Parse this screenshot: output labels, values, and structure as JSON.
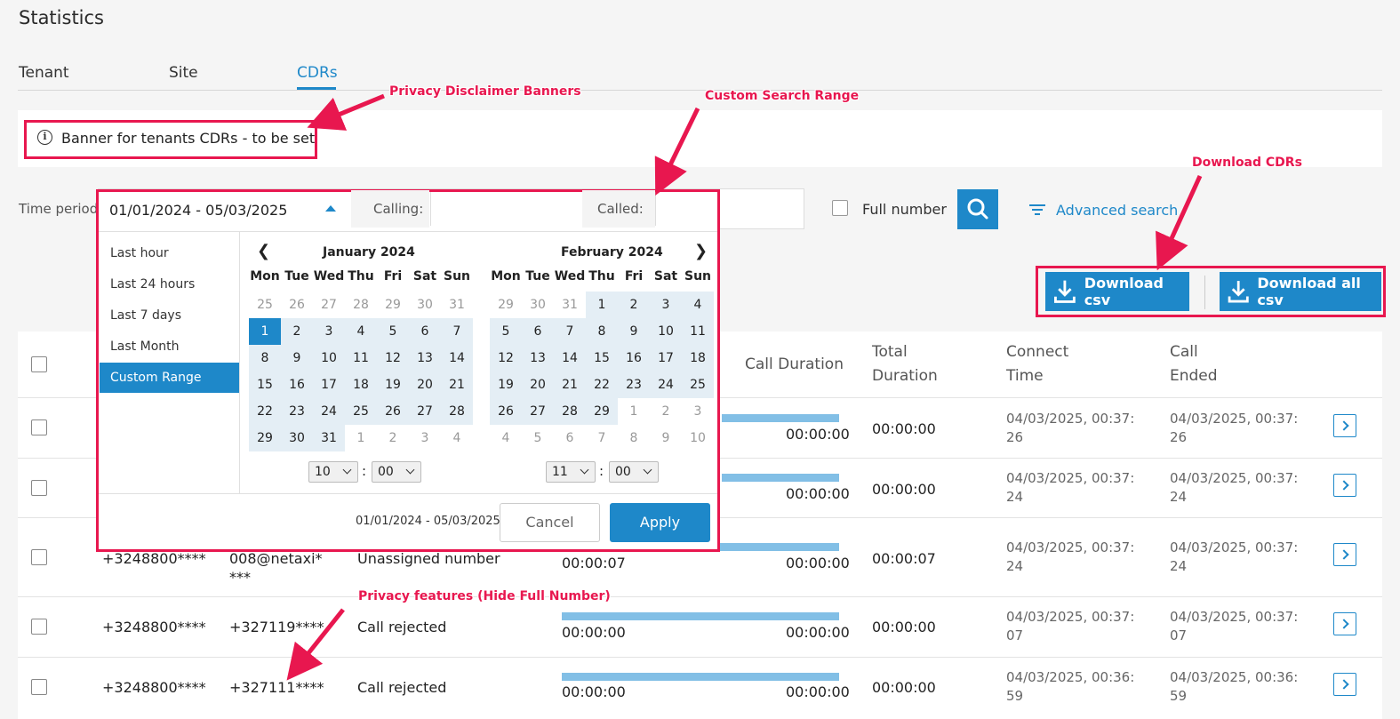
{
  "page": {
    "title": "Statistics"
  },
  "tabs": [
    {
      "label": "Tenant"
    },
    {
      "label": "Site"
    },
    {
      "label": "CDRs"
    }
  ],
  "banner": {
    "text": "Banner for tenants CDRs - to be set"
  },
  "filters": {
    "time_label": "Time period",
    "time_value": "01/01/2024 - 05/03/2025",
    "calling_label": "Calling:",
    "called_label": "Called:",
    "full_number_label": "Full number",
    "advanced_search": "Advanced search"
  },
  "downloads": {
    "csv": "Download csv",
    "all_csv": "Download all csv"
  },
  "datepicker": {
    "ranges": [
      "Last hour",
      "Last 24 hours",
      "Last 7 days",
      "Last Month",
      "Custom Range"
    ],
    "active_range": "Custom Range",
    "weekdays": [
      "Mon",
      "Tue",
      "Wed",
      "Thu",
      "Fri",
      "Sat",
      "Sun"
    ],
    "left_month": "January 2024",
    "right_month": "February 2024",
    "left_days": [
      25,
      26,
      27,
      28,
      29,
      30,
      31,
      1,
      2,
      3,
      4,
      5,
      6,
      7,
      8,
      9,
      10,
      11,
      12,
      13,
      14,
      15,
      16,
      17,
      18,
      19,
      20,
      21,
      22,
      23,
      24,
      25,
      26,
      27,
      28,
      29,
      30,
      31,
      1,
      2,
      3,
      4
    ],
    "right_days": [
      29,
      30,
      31,
      1,
      2,
      3,
      4,
      5,
      6,
      7,
      8,
      9,
      10,
      11,
      12,
      13,
      14,
      15,
      16,
      17,
      18,
      19,
      20,
      21,
      22,
      23,
      24,
      25,
      26,
      27,
      28,
      29,
      1,
      2,
      3,
      4,
      5,
      6,
      7,
      8,
      9,
      10
    ],
    "left_time": {
      "hour": "10",
      "minute": "00"
    },
    "right_time": {
      "hour": "11",
      "minute": "00"
    },
    "time_separator": ":",
    "footer_range": "01/01/2024 - 05/03/2025",
    "cancel": "Cancel",
    "apply": "Apply"
  },
  "table": {
    "headers": {
      "call_duration": "Call Duration",
      "total_duration": "Total Duration",
      "connect_time": "Connect Time",
      "call_ended": "Call Ended"
    },
    "rows": [
      {
        "calling": "",
        "called": "",
        "result": "",
        "duration": "",
        "call_duration": "00:00:00",
        "total": "00:00:00",
        "connect": "04/03/2025, 00:37:26",
        "ended": "04/03/2025, 00:37:26"
      },
      {
        "calling": "",
        "called": "",
        "result": "",
        "duration": "",
        "call_duration": "00:00:00",
        "total": "00:00:00",
        "connect": "04/03/2025, 00:37:24",
        "ended": "04/03/2025, 00:37:24"
      },
      {
        "calling": "+3248800****",
        "called": "008@netaxi****",
        "result": "Unassigned number",
        "duration": "00:00:07",
        "call_duration": "00:00:00",
        "total": "00:00:07",
        "connect": "04/03/2025, 00:37:24",
        "ended": "04/03/2025, 00:37:24"
      },
      {
        "calling": "+3248800****",
        "called": "+327119****",
        "result": "Call rejected",
        "duration": "00:00:00",
        "call_duration": "00:00:00",
        "total": "00:00:00",
        "connect": "04/03/2025, 00:37:07",
        "ended": "04/03/2025, 00:37:07"
      },
      {
        "calling": "+3248800****",
        "called": "+327111****",
        "result": "Call rejected",
        "duration": "00:00:00",
        "call_duration": "00:00:00",
        "total": "00:00:00",
        "connect": "04/03/2025, 00:36:59",
        "ended": "04/03/2025, 00:36:59"
      }
    ]
  },
  "annotations": {
    "privacy_banners": "Privacy Disclaimer Banners",
    "custom_range": "Custom Search Range",
    "download_cdrs": "Download CDRs",
    "privacy_features": "Privacy features (Hide Full Number)"
  },
  "colors": {
    "accent": "#1e88c9",
    "annotation": "#e8174f",
    "bar": "#82bfe6"
  }
}
